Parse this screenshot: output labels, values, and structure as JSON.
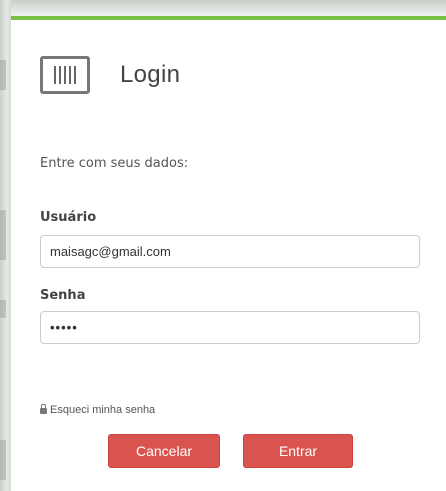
{
  "modal": {
    "title": "Login",
    "logo_icon": "barcode-icon",
    "intro_text": "Entre com seus dados:"
  },
  "form": {
    "username_label": "Usuário",
    "username_value": "maisagc@gmail.com",
    "password_label": "Senha",
    "password_value": "•••••"
  },
  "links": {
    "forgot_password": "Esqueci minha senha",
    "forgot_icon": "lock-icon"
  },
  "buttons": {
    "cancel_label": "Cancelar",
    "submit_label": "Entrar"
  },
  "colors": {
    "accent_green": "#7ac143",
    "button_red": "#d9534f"
  }
}
